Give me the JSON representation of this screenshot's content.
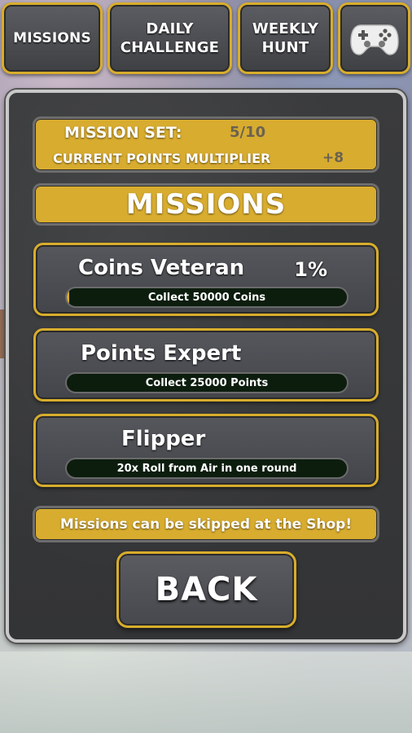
{
  "tabs": {
    "missions": "MISSIONS",
    "daily_line1": "DAILY",
    "daily_line2": "CHALLENGE",
    "weekly_line1": "WEEKLY",
    "weekly_line2": "HUNT",
    "controller_icon": "gamepad-icon"
  },
  "header": {
    "mission_set_label": "MISSION SET:",
    "mission_set_value": "5/10",
    "multiplier_label": "CURRENT POINTS MULTIPLIER",
    "multiplier_value": "+8"
  },
  "section_title": "MISSIONS",
  "missions": [
    {
      "title": "Coins Veteran",
      "percent": "1%",
      "progress": 0.01,
      "description": "Collect 50000 Coins"
    },
    {
      "title": "Points Expert",
      "percent": "",
      "progress": 0,
      "description": "Collect 25000 Points"
    },
    {
      "title": "Flipper",
      "percent": "",
      "progress": 0,
      "description": "20x Roll from Air in one round"
    }
  ],
  "shop_notice": "Missions can be skipped at the Shop!",
  "back_label": "BACK",
  "colors": {
    "accent": "#d8ac2f",
    "panel": "#3a3b3d",
    "progress_bg": "#0c1d0e"
  }
}
